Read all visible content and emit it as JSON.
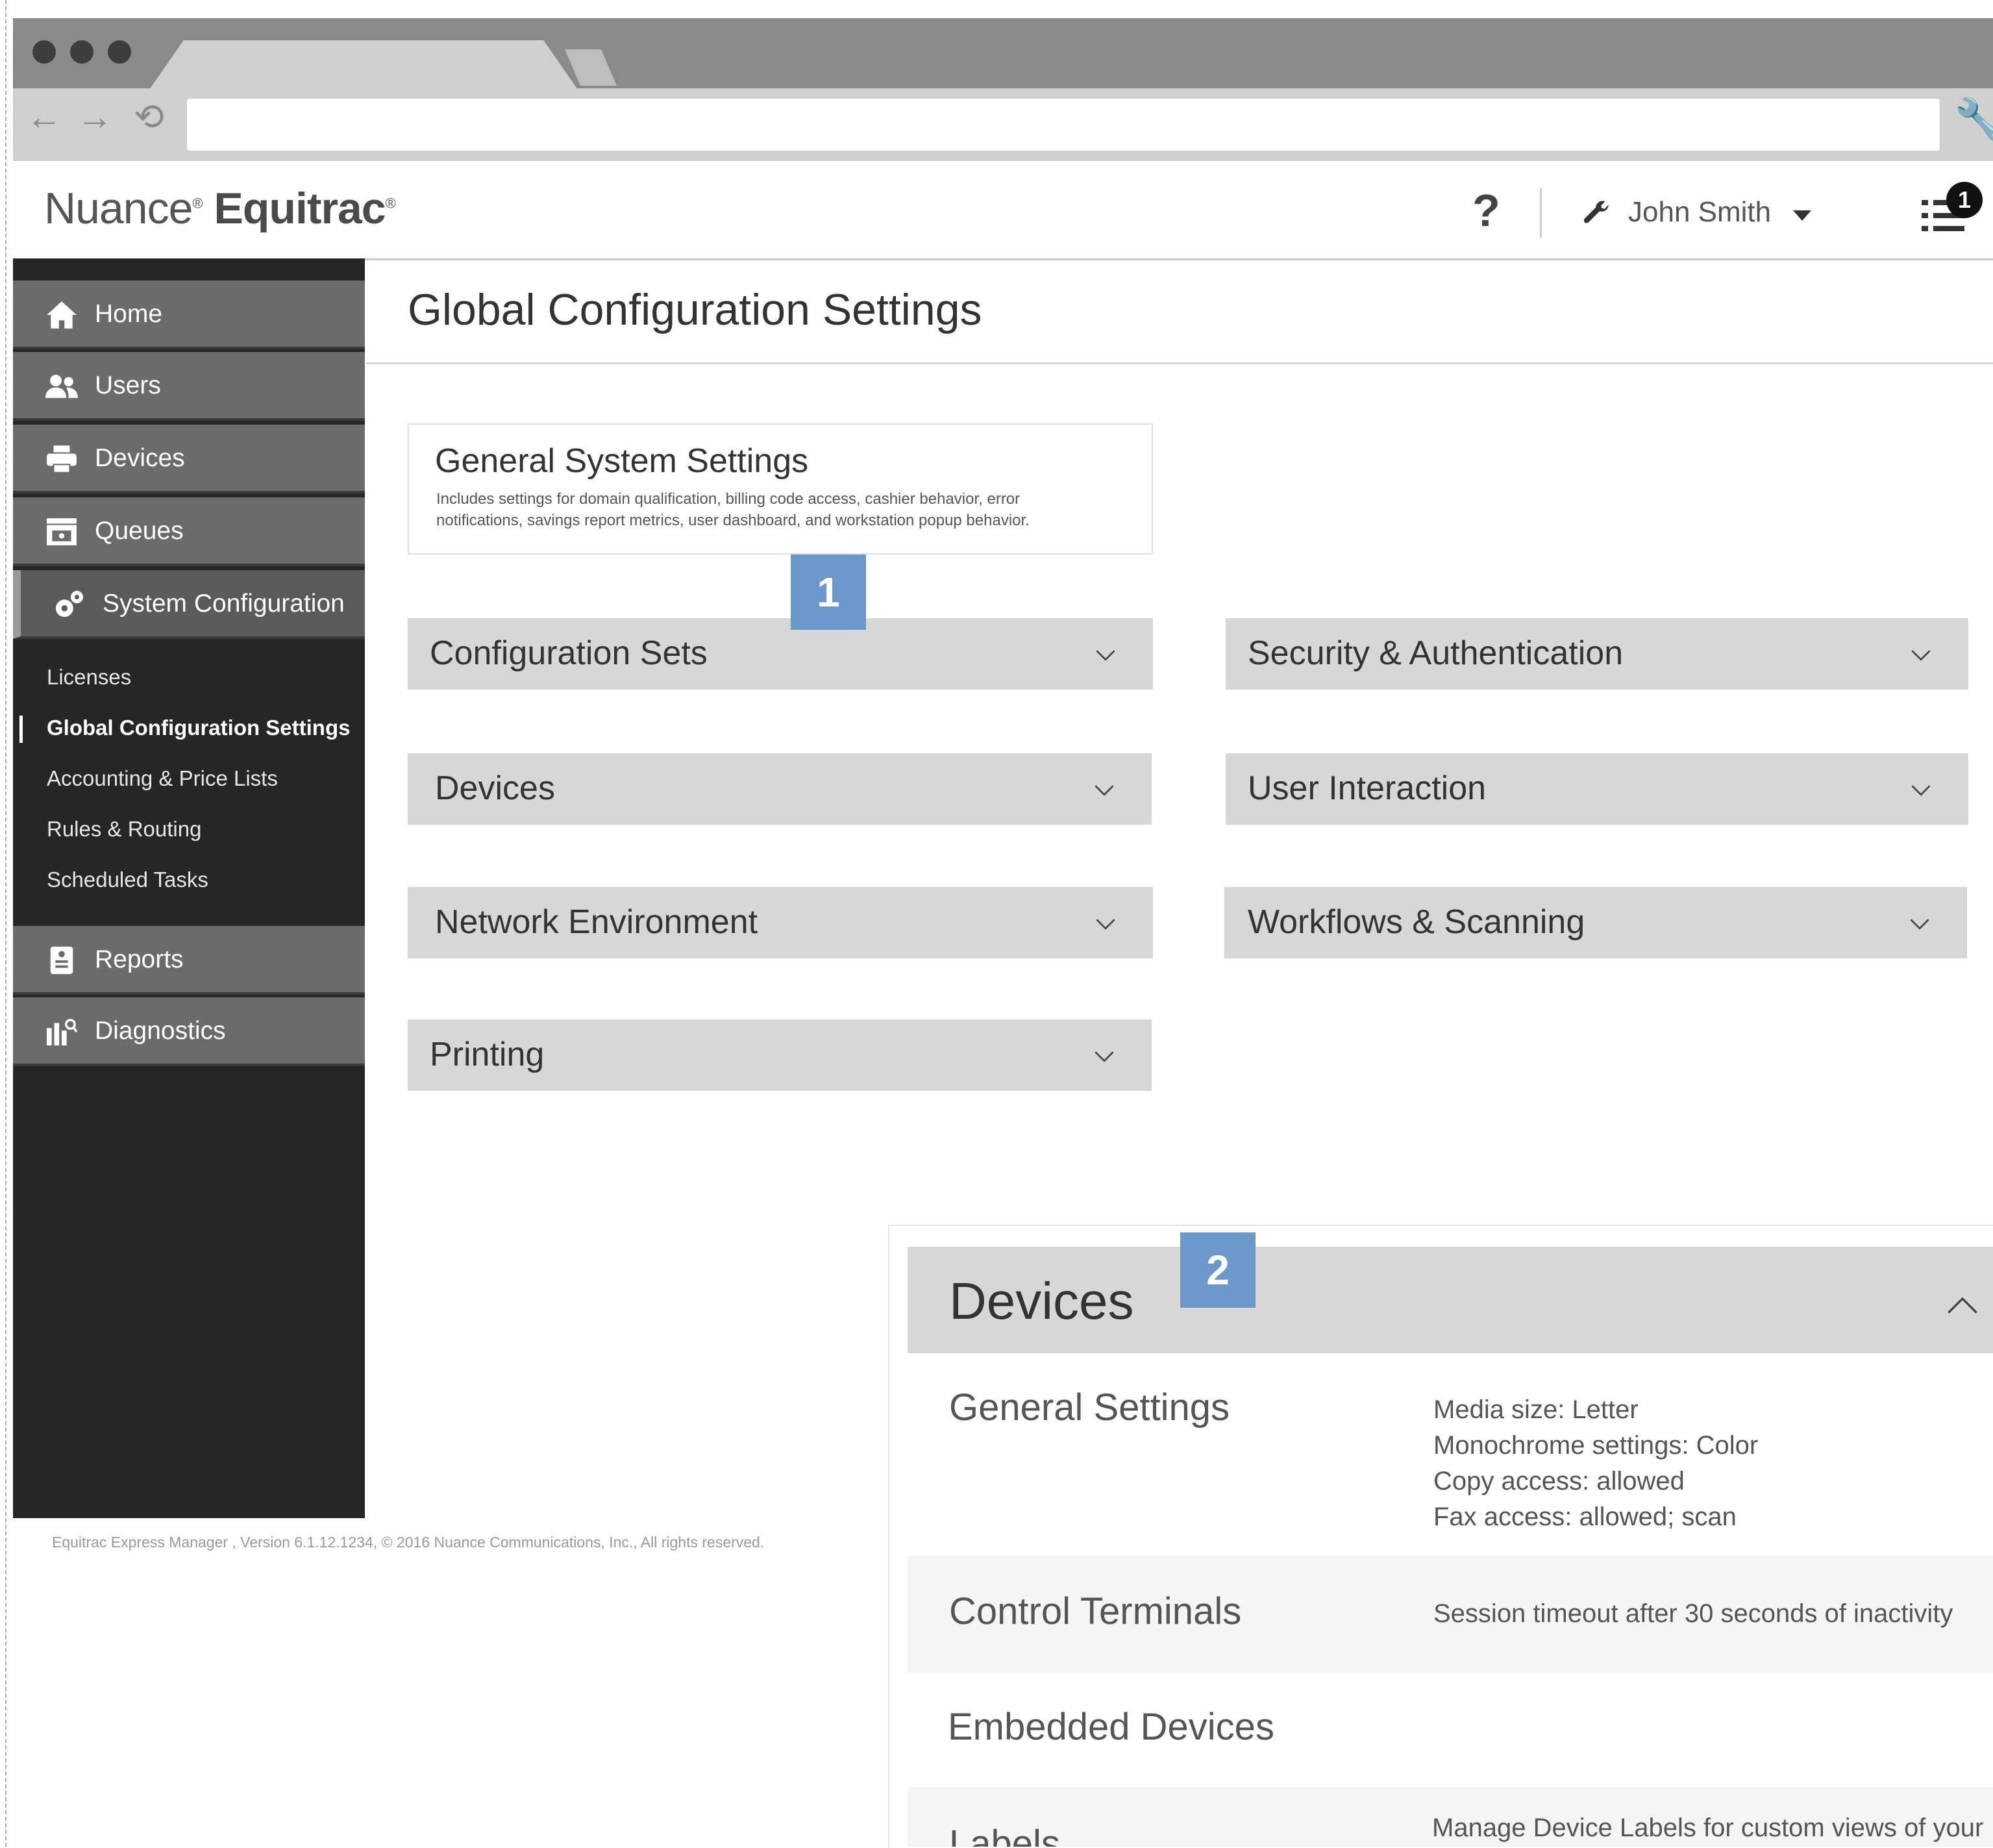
{
  "browser": {
    "nav": {
      "back": "←",
      "forward": "→",
      "reload": "⟲"
    }
  },
  "header": {
    "logo_prefix": "Nuance",
    "logo_brand": "Equitrac",
    "registered": "®",
    "help": "?",
    "user_name": "John Smith",
    "notifications_count": "1"
  },
  "sidebar": {
    "items": [
      {
        "label": "Home",
        "icon": "home-icon"
      },
      {
        "label": "Users",
        "icon": "users-icon"
      },
      {
        "label": "Devices",
        "icon": "printer-icon"
      },
      {
        "label": "Queues",
        "icon": "queue-icon"
      },
      {
        "label": "System Configuration",
        "icon": "gears-icon"
      },
      {
        "label": "Reports",
        "icon": "report-icon"
      },
      {
        "label": "Diagnostics",
        "icon": "diagnostics-icon"
      }
    ],
    "sub_items": [
      {
        "label": "Licenses"
      },
      {
        "label": "Global Configuration Settings"
      },
      {
        "label": "Accounting & Price Lists"
      },
      {
        "label": "Rules & Routing"
      },
      {
        "label": "Scheduled Tasks"
      }
    ]
  },
  "main": {
    "title": "Global Configuration Settings",
    "general_card": {
      "title": "General System Settings",
      "description": "Includes settings for domain qualification, billing code access, cashier behavior, error notifications, savings report metrics, user dashboard, and workstation popup behavior."
    },
    "markers": [
      "1",
      "2"
    ],
    "accordions_left": [
      {
        "label": "Configuration Sets"
      },
      {
        "label": "Devices"
      },
      {
        "label": "Network Environment"
      },
      {
        "label": "Printing"
      }
    ],
    "accordions_right": [
      {
        "label": "Security & Authentication"
      },
      {
        "label": "User Interaction"
      },
      {
        "label": "Workflows & Scanning"
      }
    ]
  },
  "devices_panel": {
    "title": "Devices",
    "rows": [
      {
        "label": "General Settings",
        "values": [
          "Media size: Letter",
          "Monochrome settings: Color",
          "Copy access: allowed",
          "Fax access: allowed; scan"
        ]
      },
      {
        "label": "Control Terminals",
        "values": [
          "Session timeout after 30 seconds of inactivity"
        ]
      },
      {
        "label": "Embedded Devices",
        "values": []
      },
      {
        "label": "Labels",
        "values": [
          "Manage Device Labels for custom views of your"
        ]
      }
    ]
  },
  "footer": "Equitrac Express Manager , Version 6.1.12.1234, © 2016 Nuance Communications, Inc., All rights reserved."
}
